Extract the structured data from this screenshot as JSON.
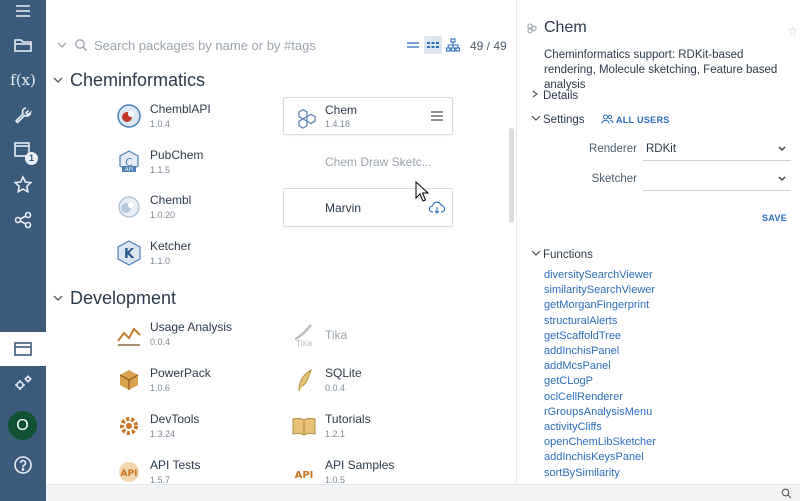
{
  "sidebar": {
    "items": [
      {
        "icon": "menu-icon"
      },
      {
        "icon": "folder-icon"
      },
      {
        "icon": "function-icon",
        "label": "f(x)"
      },
      {
        "icon": "wrench-icon"
      },
      {
        "icon": "notifications-icon",
        "badge": "1"
      },
      {
        "icon": "star-icon"
      },
      {
        "icon": "share-icon"
      },
      {
        "icon": "browse-icon"
      },
      {
        "icon": "settings-gears-icon"
      },
      {
        "icon": "help-icon"
      }
    ],
    "avatar": "O"
  },
  "search": {
    "placeholder": "Search packages by name or by #tags",
    "value": "",
    "count": "49 / 49"
  },
  "groups": [
    {
      "title": "Cheminformatics",
      "packages": [
        {
          "name": "ChemblAPI",
          "version": "1.0.4"
        },
        {
          "name": "Chem",
          "version": "1.4.18"
        },
        {
          "name": "PubChem",
          "version": "1.1.5"
        },
        {
          "name": "Chem Draw Sketc...",
          "version": ""
        },
        {
          "name": "Chembl",
          "version": "1.0.20"
        },
        {
          "name": "Marvin",
          "version": ""
        },
        {
          "name": "Ketcher",
          "version": "1.1.0"
        }
      ]
    },
    {
      "title": "Development",
      "packages": [
        {
          "name": "Usage Analysis",
          "version": "0.0.4"
        },
        {
          "name": "Tika",
          "version": ""
        },
        {
          "name": "PowerPack",
          "version": "1.0.6"
        },
        {
          "name": "SQLite",
          "version": "0.0.4"
        },
        {
          "name": "DevTools",
          "version": "1.3.24"
        },
        {
          "name": "Tutorials",
          "version": "1.2.1"
        },
        {
          "name": "API Tests",
          "version": "1.5.7"
        },
        {
          "name": "API Samples",
          "version": "1.0.5"
        }
      ]
    }
  ],
  "panel": {
    "title": "Chem",
    "description": "Cheminformatics support: RDKit-based rendering, Molecule sketching, Feature based analysis",
    "details_label": "Details",
    "settings_label": "Settings",
    "all_users_label": "ALL USERS",
    "renderer_label": "Renderer",
    "renderer_value": "RDKit",
    "sketcher_label": "Sketcher",
    "sketcher_value": "",
    "save_label": "SAVE",
    "functions_label": "Functions",
    "functions": [
      "diversitySearchViewer",
      "similaritySearchViewer",
      "getMorganFingerprint",
      "structuralAlerts",
      "getScaffoldTree",
      "addInchisPanel",
      "addMcsPanel",
      "getCLogP",
      "oclCellRenderer",
      "rGroupsAnalysisMenu",
      "activityCliffs",
      "openChemLibSketcher",
      "addInchisKeysPanel",
      "sortBySimilarity"
    ]
  },
  "colors": {
    "sidebar": "#3c5a7a",
    "accent": "#2a6ebd",
    "avatar": "#0f5132"
  }
}
